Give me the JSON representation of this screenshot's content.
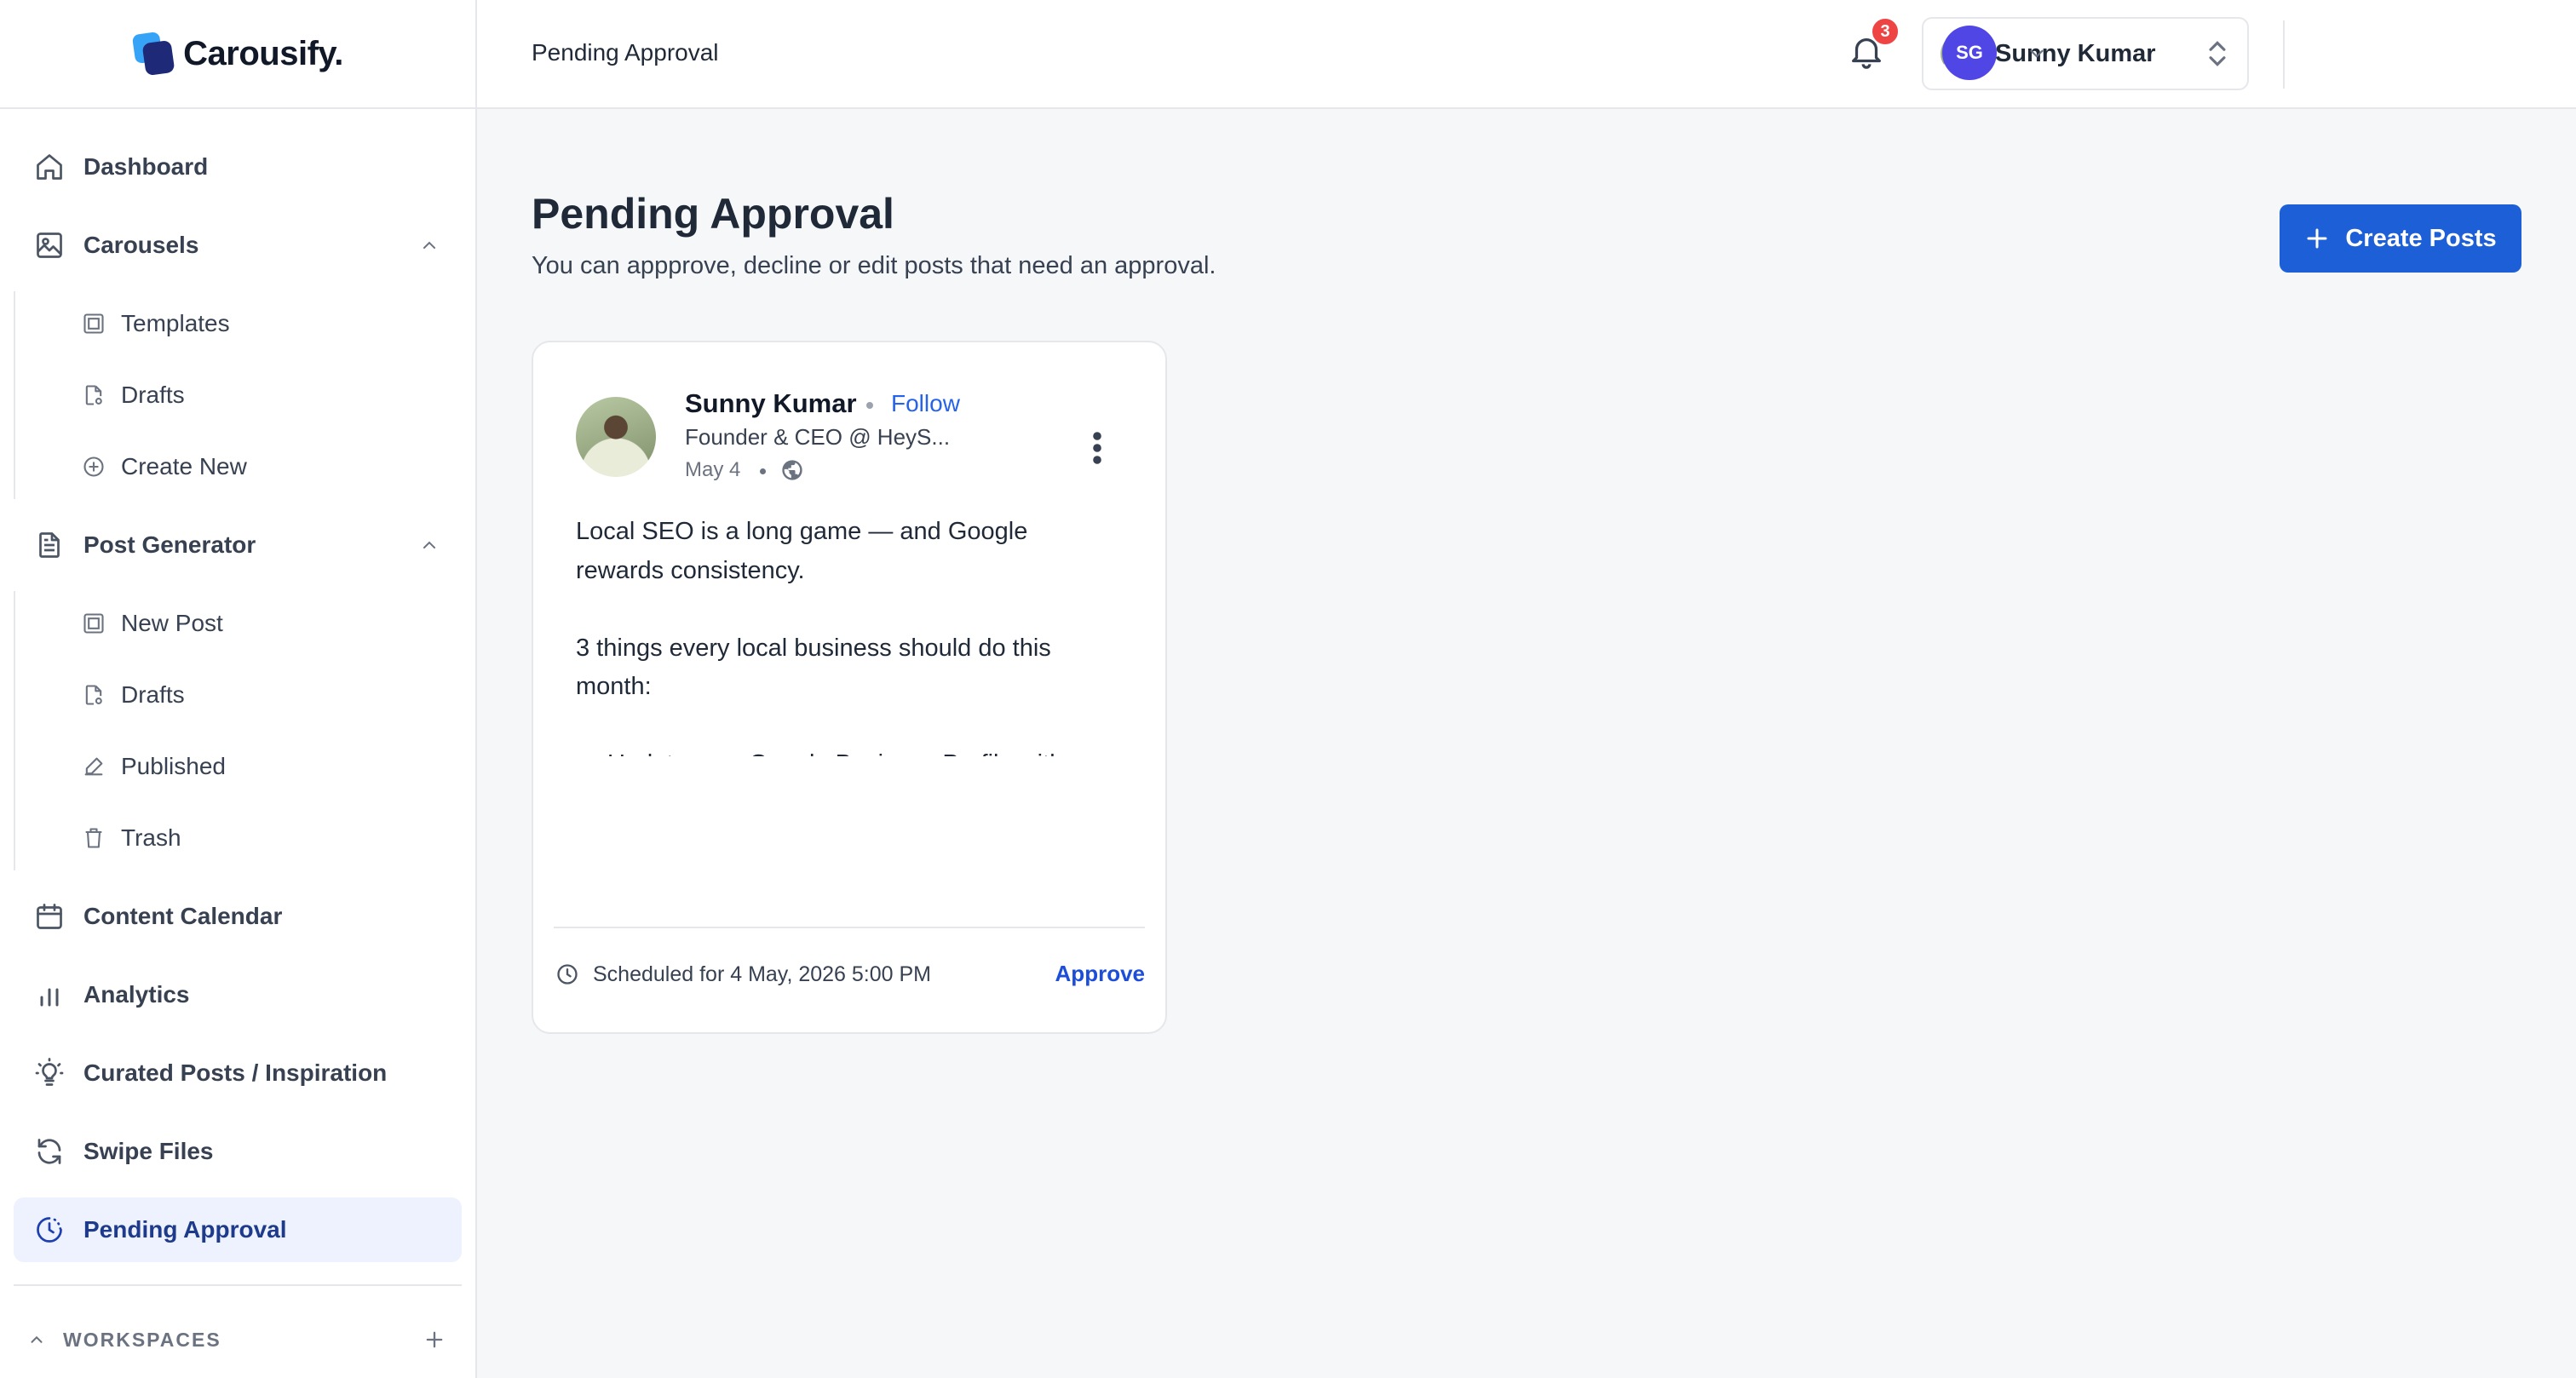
{
  "brand": {
    "name": "Carousify."
  },
  "sidebar": {
    "dashboard": "Dashboard",
    "carousels": {
      "label": "Carousels",
      "items": [
        "Templates",
        "Drafts",
        "Create New"
      ]
    },
    "post_generator": {
      "label": "Post Generator",
      "items": [
        "New Post",
        "Drafts",
        "Published",
        "Trash"
      ]
    },
    "content_calendar": "Content Calendar",
    "analytics": "Analytics",
    "curated": "Curated Posts / Inspiration",
    "swipe_files": "Swipe Files",
    "pending_approval": "Pending Approval",
    "workspaces": "WORKSPACES"
  },
  "topbar": {
    "breadcrumb": "Pending Approval",
    "account_name": "Sunny Kumar",
    "notification_count": "3",
    "user_initials": "SG"
  },
  "main": {
    "title": "Pending Approval",
    "subtitle": "You can appprove, decline or edit posts that need an approval.",
    "create_button": "Create Posts"
  },
  "post": {
    "author": "Sunny Kumar",
    "follow": "Follow",
    "headline": "Founder & CEO @ HeyS...",
    "date": "May 4",
    "body": "Local SEO is a long game — and Google rewards consistency.\n\n3 things every local business should do this month:\n\n→ Update your Google Business Profile with fresh photos\n→ Reply to every review (yes, the bad ones too)\n→ Add a \"near me\" section on your service",
    "scheduled": "Scheduled for 4 May, 2026 5:00 PM",
    "approve": "Approve"
  },
  "colors": {
    "accent": "#1d5fd6",
    "active_bg": "#eef2ff",
    "badge": "#ef4444",
    "avatar": "#4f46e5"
  }
}
